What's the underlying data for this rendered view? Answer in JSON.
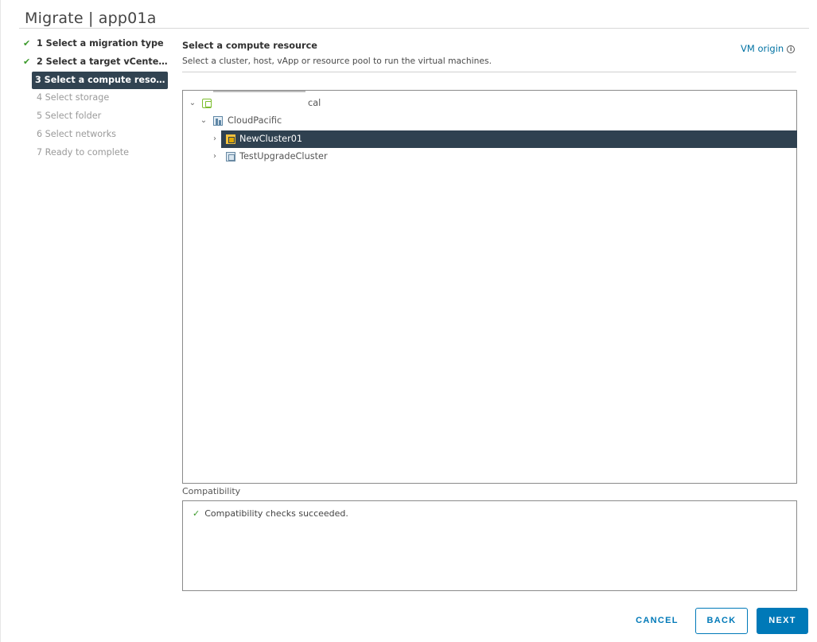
{
  "window": {
    "title": "Migrate | app01a"
  },
  "steps": [
    {
      "label": "1 Select a migration type",
      "state": "done"
    },
    {
      "label": "2 Select a target vCenter S...",
      "state": "done"
    },
    {
      "label": "3 Select a compute resource",
      "state": "current"
    },
    {
      "label": "4 Select storage",
      "state": "todo"
    },
    {
      "label": "5 Select folder",
      "state": "todo"
    },
    {
      "label": "6 Select networks",
      "state": "todo"
    },
    {
      "label": "7 Ready to complete",
      "state": "todo"
    }
  ],
  "main": {
    "title": "Select a compute resource",
    "subtitle": "Select a cluster, host, vApp or resource pool to run the virtual machines.",
    "vm_origin": "VM origin"
  },
  "tree": {
    "root": {
      "label": "cal",
      "expanded": true
    },
    "datacenter": {
      "label": "CloudPacific",
      "expanded": true
    },
    "clusters": [
      {
        "label": "NewCluster01",
        "selected": true
      },
      {
        "label": "TestUpgradeCluster",
        "selected": false
      }
    ]
  },
  "compatibility": {
    "label": "Compatibility",
    "message": "Compatibility checks succeeded."
  },
  "buttons": {
    "cancel": "CANCEL",
    "back": "BACK",
    "next": "NEXT"
  },
  "icons": {
    "check": "check-icon",
    "info": "info-icon",
    "vcenter": "vcenter-icon",
    "datacenter": "datacenter-icon",
    "cluster": "cluster-icon"
  },
  "colors": {
    "accent": "#0079b8",
    "selected_bg": "#2f4150",
    "success": "#3c9a2c"
  }
}
